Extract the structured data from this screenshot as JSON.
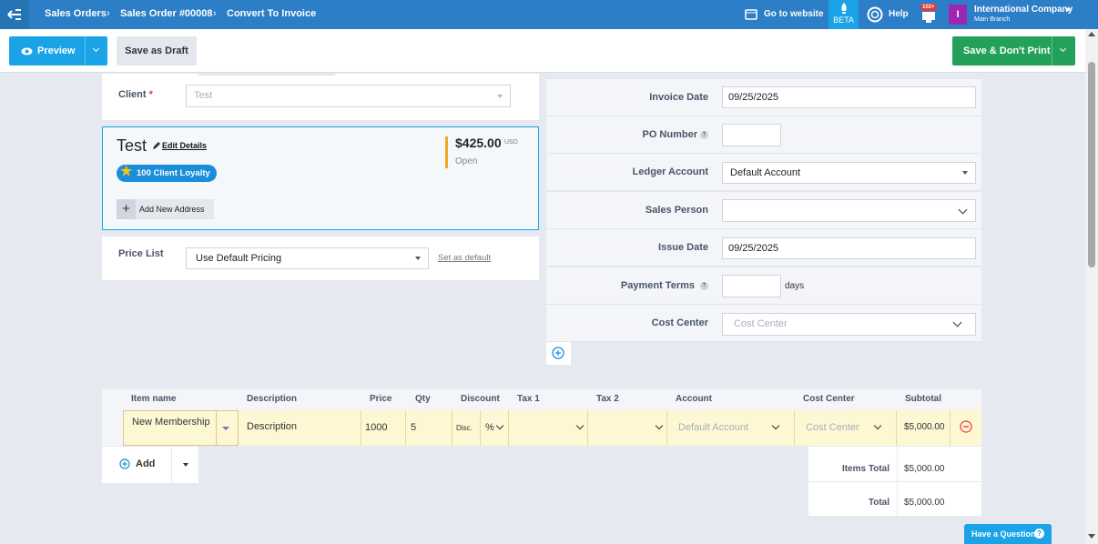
{
  "topbar": {
    "breadcrumb": [
      "Sales Orders",
      "Sales Order #00008",
      "Convert To Invoice"
    ],
    "go_to_website": "Go to website",
    "beta": "BETA",
    "help": "Help",
    "notifications_badge": "102+",
    "avatar_letter": "I",
    "company": "International Company",
    "branch": "Main Branch"
  },
  "toolbar": {
    "preview": "Preview",
    "save_draft": "Save as Draft",
    "save_dont_print": "Save & Don't Print"
  },
  "client": {
    "label": "Client",
    "required_mark": "*",
    "placeholder": "Test",
    "name": "Test",
    "edit_details": "Edit Details",
    "loyalty": "100 Client Loyalty",
    "amount": "$425.00",
    "currency": "USD",
    "status": "Open",
    "add_address": "Add New Address"
  },
  "price_list": {
    "label": "Price List",
    "value": "Use Default Pricing",
    "set_default": "Set as default"
  },
  "invoice": {
    "invoice_date_label": "Invoice Date",
    "invoice_date": "09/25/2025",
    "po_number_label": "PO Number",
    "po_number": "",
    "ledger_label": "Ledger Account",
    "ledger": "Default Account",
    "sales_person_label": "Sales Person",
    "sales_person": "",
    "issue_date_label": "Issue Date",
    "issue_date": "09/25/2025",
    "payment_terms_label": "Payment Terms",
    "payment_terms": "",
    "days": "days",
    "cost_center_label": "Cost Center",
    "cost_center_placeholder": "Cost Center"
  },
  "items": {
    "headers": {
      "item_name": "Item name",
      "description": "Description",
      "price": "Price",
      "qty": "Qty",
      "discount": "Discount",
      "tax1": "Tax 1",
      "tax2": "Tax 2",
      "account": "Account",
      "cost_center": "Cost Center",
      "subtotal": "Subtotal"
    },
    "row": {
      "item_name": "New Membership",
      "description": "Description",
      "price": "1000",
      "qty": "5",
      "disc": "Disc.",
      "disc_type": "%",
      "account_placeholder": "Default Account",
      "cost_center_placeholder": "Cost Center",
      "subtotal": "$5,000.00"
    },
    "add": "Add",
    "items_total_label": "Items Total",
    "items_total": "$5,000.00",
    "total_label": "Total",
    "total": "$5,000.00"
  },
  "help_question": "Have a Question",
  "colors": {
    "topbar": "#2c7ec6",
    "accent": "#1aa3e6",
    "save": "#23a15a",
    "highlight": "#fdf7d4"
  }
}
